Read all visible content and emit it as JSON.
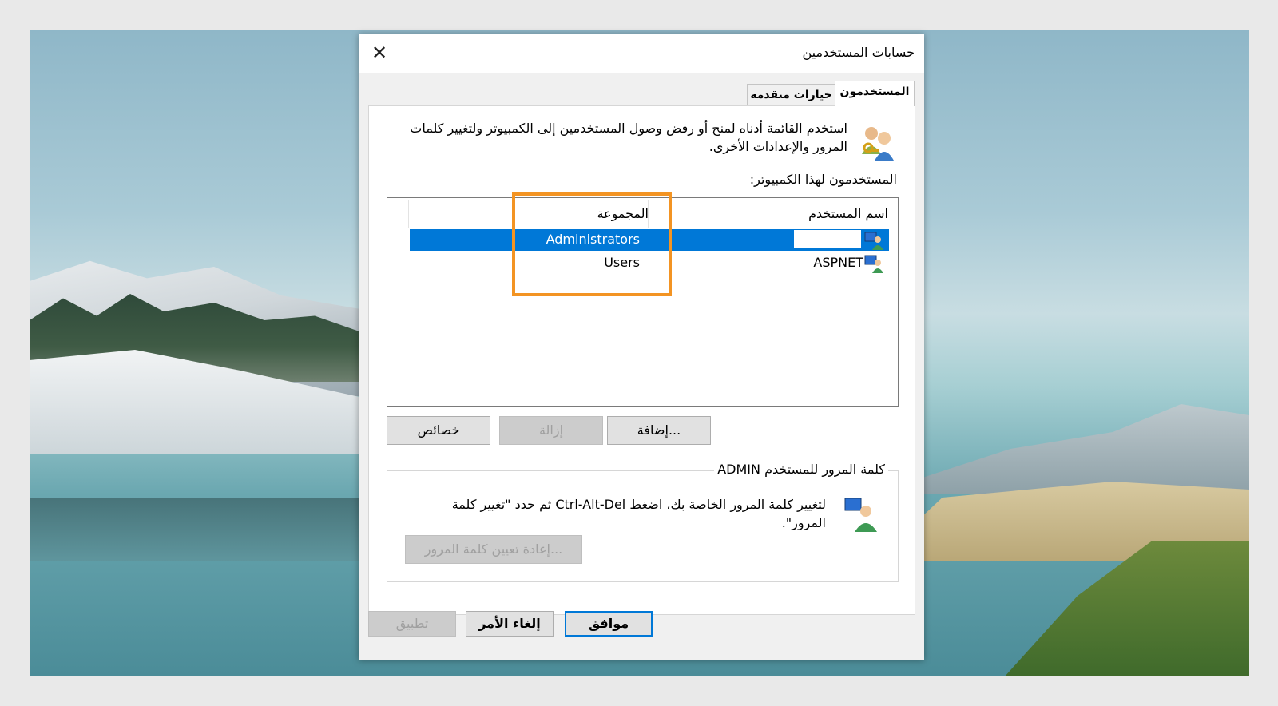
{
  "window": {
    "title": "حسابات المستخدمين",
    "close_icon": "close-icon"
  },
  "tabs": [
    {
      "label": "المستخدمون",
      "active": true
    },
    {
      "label": "خيارات متقدمة",
      "active": false
    }
  ],
  "intro": {
    "icon": "users-keys-icon",
    "text": "استخدم القائمة أدناه لمنح أو رفض وصول المستخدمين إلى الكمبيوتر ولتغيير كلمات المرور والإعدادات الأخرى."
  },
  "users_label": "المستخدمون لهذا الكمبيوتر:",
  "listview": {
    "columns": {
      "name": "اسم المستخدم",
      "group": "المجموعة"
    },
    "rows": [
      {
        "name": "",
        "group": "Administrators",
        "selected": true,
        "icon": "user-icon"
      },
      {
        "name": "ASPNET",
        "group": "Users",
        "selected": false,
        "icon": "user-icon"
      }
    ]
  },
  "buttons": {
    "add": "إضافة...",
    "remove": "إزالة",
    "properties": "خصائص"
  },
  "password_group": {
    "legend": "كلمة المرور للمستخدم ADMIN",
    "icon": "user-screen-icon",
    "text": "لتغيير كلمة المرور الخاصة بك، اضغط Ctrl-Alt-Del ثم حدد \"تغيير كلمة المرور\".",
    "reset_button": "إعادة تعيين كلمة المرور..."
  },
  "footer": {
    "ok": "موافق",
    "cancel": "إلغاء الأمر",
    "apply": "تطبيق"
  },
  "colors": {
    "selection": "#0078d7",
    "highlight_box": "#f39423"
  }
}
